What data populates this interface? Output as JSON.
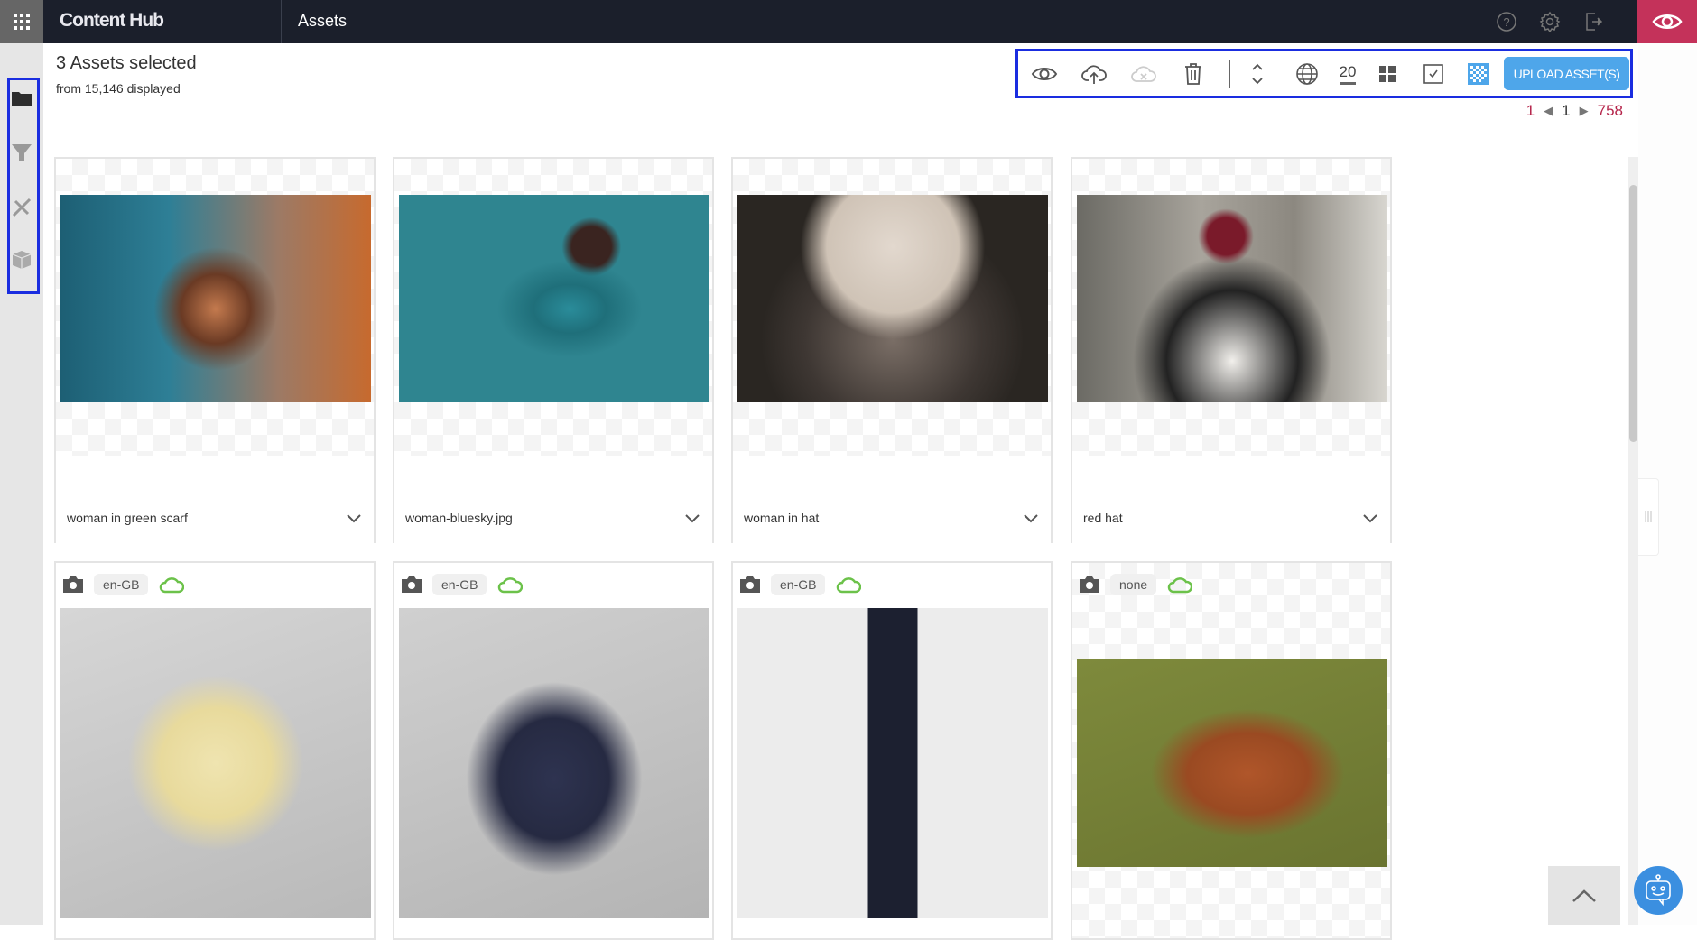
{
  "header": {
    "brand": "Content Hub",
    "section": "Assets",
    "icons": [
      "apps-grid-icon",
      "help-icon",
      "settings-gear-icon",
      "logout-icon",
      "preview-eye-icon"
    ]
  },
  "sidebar": {
    "items": [
      {
        "name": "folder-icon"
      },
      {
        "name": "filter-icon"
      },
      {
        "name": "tools-icon"
      },
      {
        "name": "box-icon"
      }
    ]
  },
  "selection": {
    "title": "3 Assets selected",
    "subtitle": "from 15,146 displayed"
  },
  "toolbar": {
    "icons": [
      "eye-icon",
      "cloud-upload-icon",
      "cloud-remove-icon",
      "trash-icon",
      "sort-icon",
      "globe-icon",
      "page-size",
      "grid-view-icon",
      "select-checkbox-icon",
      "transparency-icon"
    ],
    "page_size": "20",
    "upload_label": "UPLOAD ASSET(S)",
    "accent": "#4ea6ea"
  },
  "pagination": {
    "first": "1",
    "current": "1",
    "last": "758"
  },
  "assets_row1": [
    {
      "title": "woman in green scarf"
    },
    {
      "title": "woman-bluesky.jpg"
    },
    {
      "title": "woman in hat"
    },
    {
      "title": "red hat"
    }
  ],
  "assets_row2": [
    {
      "locale": "en-GB",
      "type": "camera-icon",
      "status": "cloud-published-icon"
    },
    {
      "locale": "en-GB",
      "type": "camera-icon",
      "status": "cloud-published-icon"
    },
    {
      "locale": "en-GB",
      "type": "camera-icon",
      "status": "cloud-published-icon"
    },
    {
      "locale": "none",
      "type": "camera-icon",
      "status": "cloud-published-icon"
    }
  ],
  "colors": {
    "topbar": "#1b1f2b",
    "accent_red": "#c4325a",
    "link_red": "#b5244a",
    "cloud_green": "#6cc24a",
    "selection_outline": "#1a2de0"
  }
}
